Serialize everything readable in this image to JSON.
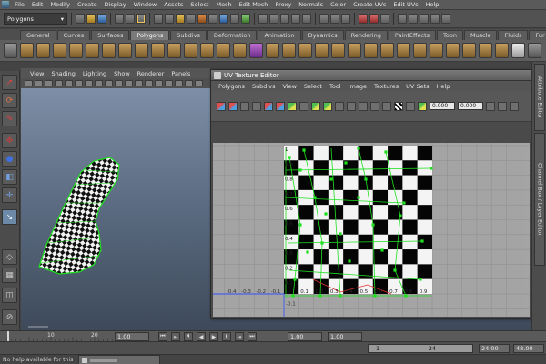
{
  "menubar": {
    "items": [
      "File",
      "Edit",
      "Modify",
      "Create",
      "Display",
      "Window",
      "Assets",
      "Select",
      "Mesh",
      "Edit Mesh",
      "Proxy",
      "Normals",
      "Color",
      "Create UVs",
      "Edit UVs",
      "Help"
    ]
  },
  "status": {
    "mode": "Polygons"
  },
  "shelf": {
    "tabs": [
      "General",
      "Curves",
      "Surfaces",
      "Polygons",
      "Subdivs",
      "Deformation",
      "Animation",
      "Dynamics",
      "Rendering",
      "PaintEffects",
      "Toon",
      "Muscle",
      "Fluids",
      "Fur"
    ],
    "active_tab": "Polygons"
  },
  "viewport": {
    "menu": [
      "View",
      "Shading",
      "Lighting",
      "Show",
      "Renderer",
      "Panels"
    ]
  },
  "uv_editor": {
    "title": "UV Texture Editor",
    "menu": [
      "Polygons",
      "Subdivs",
      "View",
      "Select",
      "Tool",
      "Image",
      "Textures",
      "UV Sets",
      "Help"
    ],
    "field_a": "0.000",
    "field_b": "0.000",
    "v_labels": [
      "1",
      "0.9",
      "0.8",
      "0.7",
      "0.6",
      "0.5",
      "0.4",
      "0.3",
      "0.2",
      "0.1"
    ],
    "u_labels_pos": [
      "0.1",
      "0.2",
      "0.3",
      "0.4",
      "0.5",
      "0.6",
      "0.7",
      "0.8",
      "0.9"
    ],
    "u_labels_neg": [
      "-0.4",
      "-0.3",
      "-0.2",
      "-0.1"
    ],
    "below_label": "-0.1"
  },
  "side_tabs": [
    "Attribute Editor",
    "Channel Box / Layer Editor"
  ],
  "timeline": {
    "ticks": [
      "10",
      "20"
    ],
    "start": "1.00",
    "start2": "1.00",
    "current": "1",
    "end_frame": "24",
    "range_end": "24.00",
    "end": "48.00"
  },
  "help": {
    "text": "No help available for this"
  },
  "colors": {
    "uv_green": "#1fe01f",
    "selection_blue": "#3050ff"
  }
}
